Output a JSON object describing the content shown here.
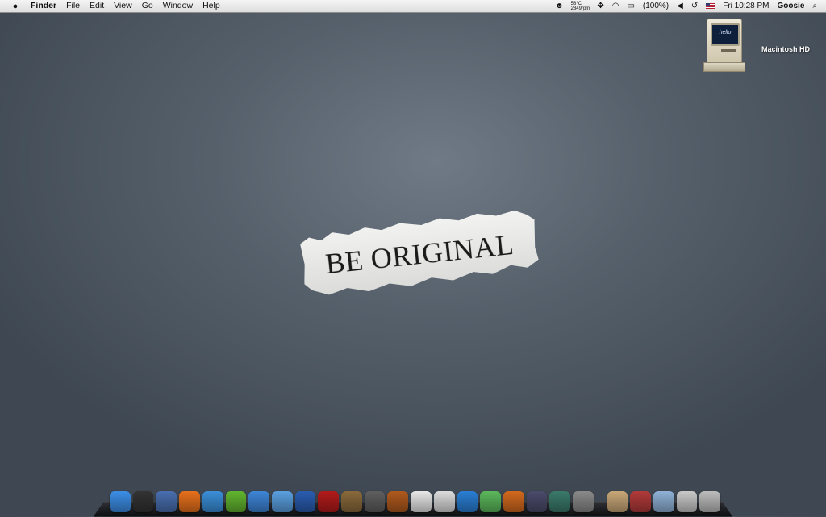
{
  "menubar": {
    "apple": "",
    "app_name": "Finder",
    "menus": [
      "File",
      "Edit",
      "View",
      "Go",
      "Window",
      "Help"
    ],
    "temperature": "58°C",
    "fan_rpm": "2849rpm",
    "battery": "(100%)",
    "clock": "Fri 10:28 PM",
    "user": "Goosie"
  },
  "desktop": {
    "drive_label": "Macintosh HD",
    "drive_screen_text": "hello",
    "wallpaper_text": "BE ORIGINAL"
  },
  "dock": {
    "apps": [
      {
        "icon": "finder-icon",
        "color": "#3c8ee6"
      },
      {
        "icon": "dashboard-icon",
        "color": "#333333"
      },
      {
        "icon": "preview-icon",
        "color": "#4a6fb0"
      },
      {
        "icon": "firefox-icon",
        "color": "#e8711c"
      },
      {
        "icon": "safari-icon",
        "color": "#3b8fd9"
      },
      {
        "icon": "green-app-icon",
        "color": "#62b52f"
      },
      {
        "icon": "ichat-icon",
        "color": "#3e86d8"
      },
      {
        "icon": "mail-icon",
        "color": "#5aa0e0"
      },
      {
        "icon": "dvd-player-icon",
        "color": "#2a5db0"
      },
      {
        "icon": "photo-booth-icon",
        "color": "#b31b1b"
      },
      {
        "icon": "iphoto-icon",
        "color": "#8a6a3b"
      },
      {
        "icon": "imovie-icon",
        "color": "#5f5f5f"
      },
      {
        "icon": "garageband-icon",
        "color": "#b05a1e"
      },
      {
        "icon": "textedit-icon",
        "color": "#e8e8e8"
      },
      {
        "icon": "flickr-uploadr-icon",
        "color": "#dcdcdc"
      },
      {
        "icon": "quicktime-icon",
        "color": "#2a7fd4"
      },
      {
        "icon": "itunes-icon",
        "color": "#5cb85c"
      },
      {
        "icon": "keynote-icon",
        "color": "#d2691e"
      },
      {
        "icon": "automator-icon",
        "color": "#4b4b6b"
      },
      {
        "icon": "time-machine-icon",
        "color": "#3a7a6a"
      },
      {
        "icon": "system-preferences-icon",
        "color": "#8a8a8a"
      }
    ],
    "stacks": [
      {
        "icon": "applications-stack-icon",
        "color": "#c9a878"
      },
      {
        "icon": "utilities-stack-icon",
        "color": "#b23a3a"
      },
      {
        "icon": "documents-stack-icon",
        "color": "#8fb2d6"
      },
      {
        "icon": "downloads-stack-icon",
        "color": "#c9c9c9"
      },
      {
        "icon": "trash-icon",
        "color": "#bdbdbd"
      }
    ]
  }
}
